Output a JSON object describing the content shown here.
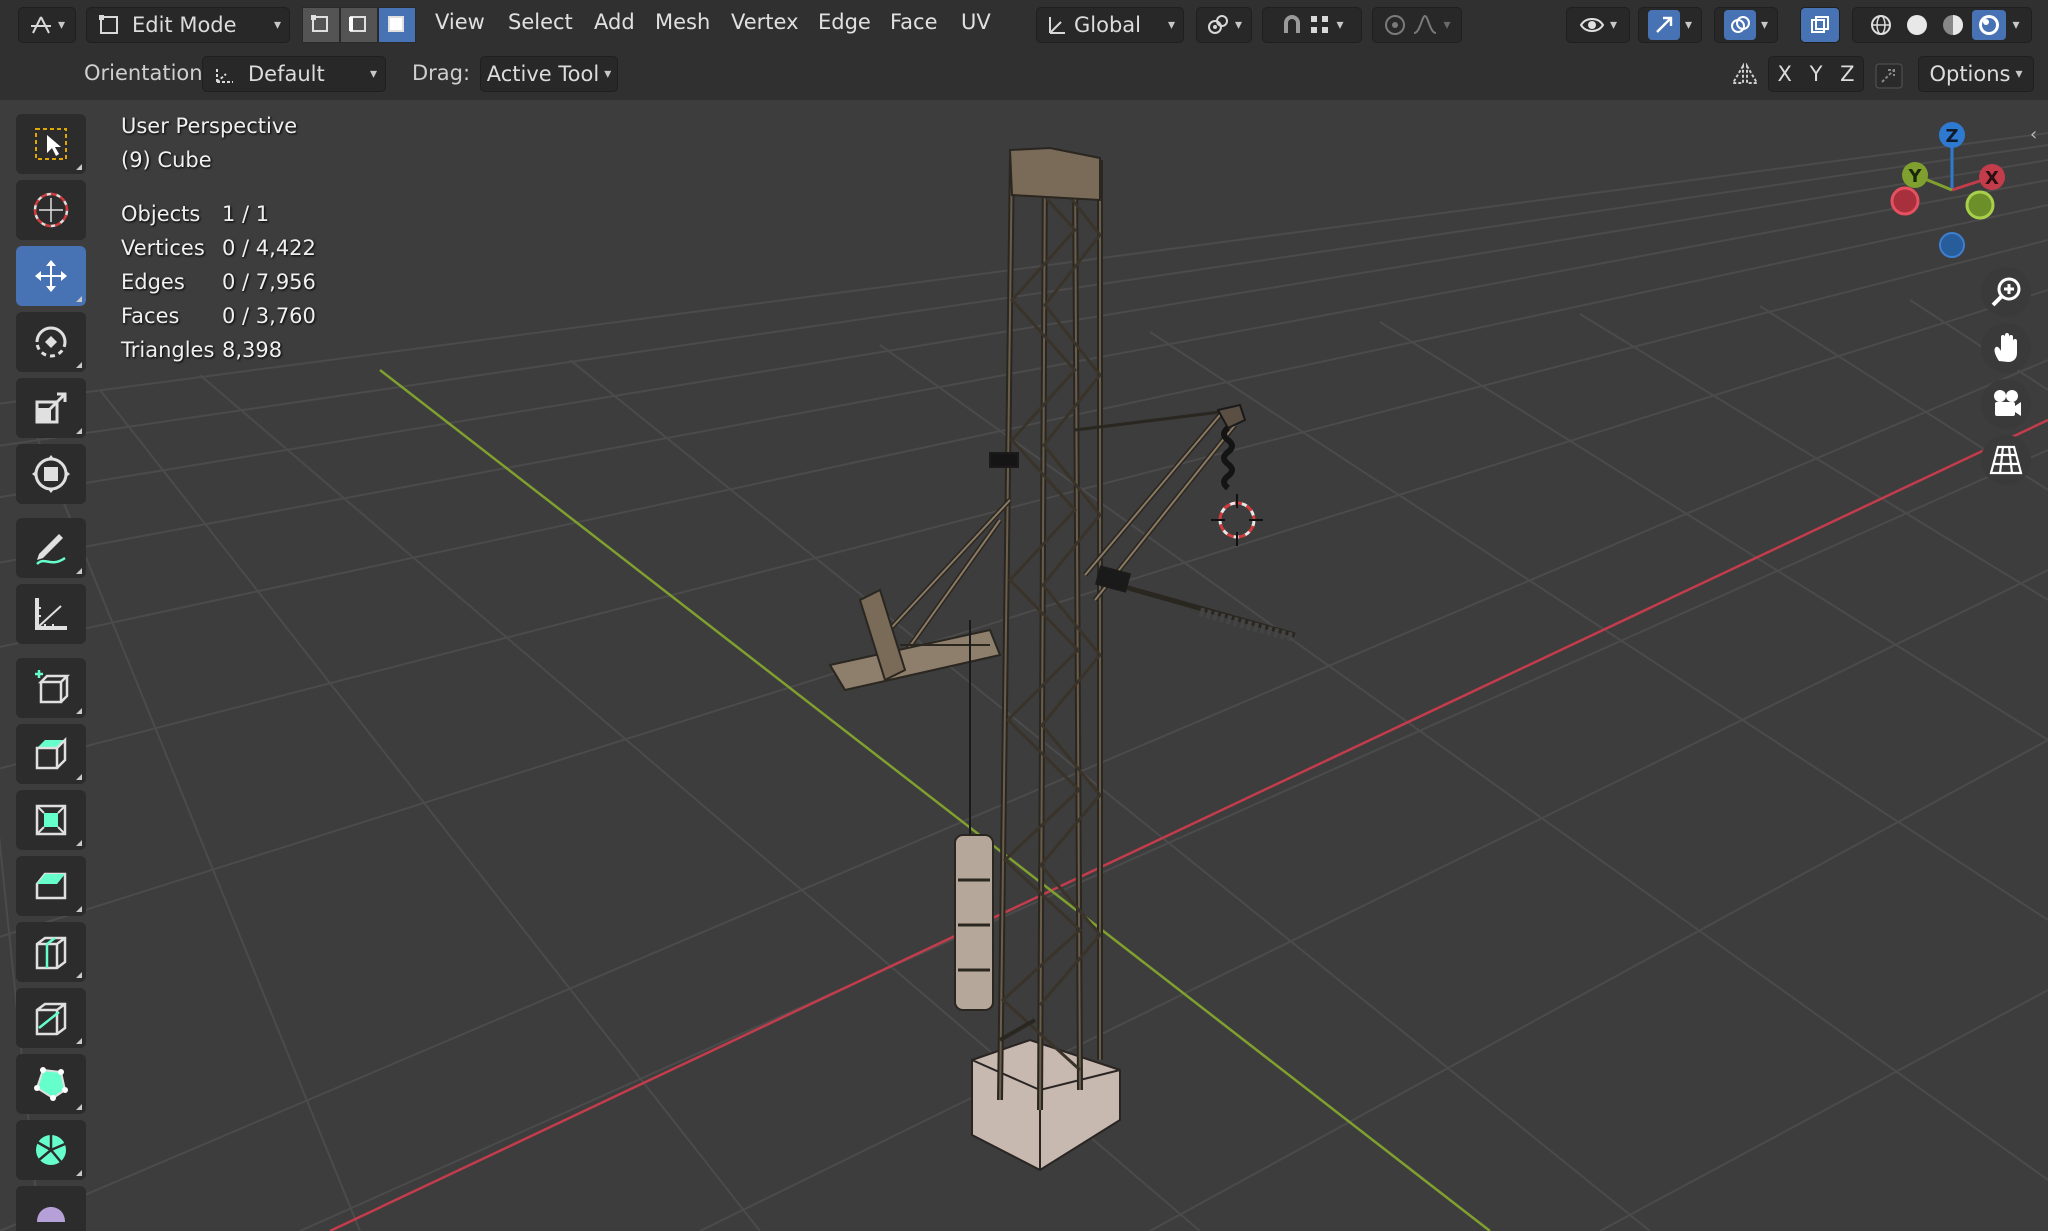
{
  "header": {
    "editor_type_icon": "transform-gizmo-icon",
    "mode": {
      "label": "Edit Mode",
      "icon": "edit-mode-icon"
    },
    "select_modes": [
      "vertex-select-icon",
      "edge-select-icon",
      "face-select-icon"
    ],
    "active_select_mode": 2,
    "menus": [
      "View",
      "Select",
      "Add",
      "Mesh",
      "Vertex",
      "Edge",
      "Face",
      "UV"
    ],
    "transform_orientation": "Global",
    "viewport_shading_active": 3
  },
  "toolsettings": {
    "orientation_label": "Orientation:",
    "orientation_value": "Default",
    "drag_label": "Drag:",
    "drag_value": "Active Tool",
    "axis_x": "X",
    "axis_y": "Y",
    "axis_z": "Z",
    "options_label": "Options"
  },
  "overlay": {
    "view_name": "User Perspective",
    "object_name": "(9) Cube",
    "stats": [
      {
        "label": "Objects",
        "value": "1 / 1"
      },
      {
        "label": "Vertices",
        "value": "0 / 4,422"
      },
      {
        "label": "Edges",
        "value": "0 / 7,956"
      },
      {
        "label": "Faces",
        "value": "0 / 3,760"
      },
      {
        "label": "Triangles",
        "value": "8,398"
      }
    ]
  },
  "gizmo": {
    "x": "X",
    "y": "Y",
    "z": "Z"
  },
  "toolbar": [
    "select-box-icon",
    "cursor-icon",
    "move-icon",
    "rotate-icon",
    "scale-icon",
    "transform-icon",
    "annotate-icon",
    "measure-icon",
    "add-cube-icon",
    "extrude-icon",
    "inset-icon",
    "bevel-icon",
    "loop-cut-icon",
    "knife-icon",
    "poly-build-icon",
    "spin-icon",
    "smooth-icon"
  ],
  "active_tool": 2,
  "colors": {
    "accent": "#4772b3",
    "x_axis": "#c33c4c",
    "y_axis": "#7fa02e",
    "z_axis": "#2f7ad1",
    "grid": "#4a4a4a",
    "header_bg": "#303030",
    "viewport_bg": "#3d3d3d"
  }
}
